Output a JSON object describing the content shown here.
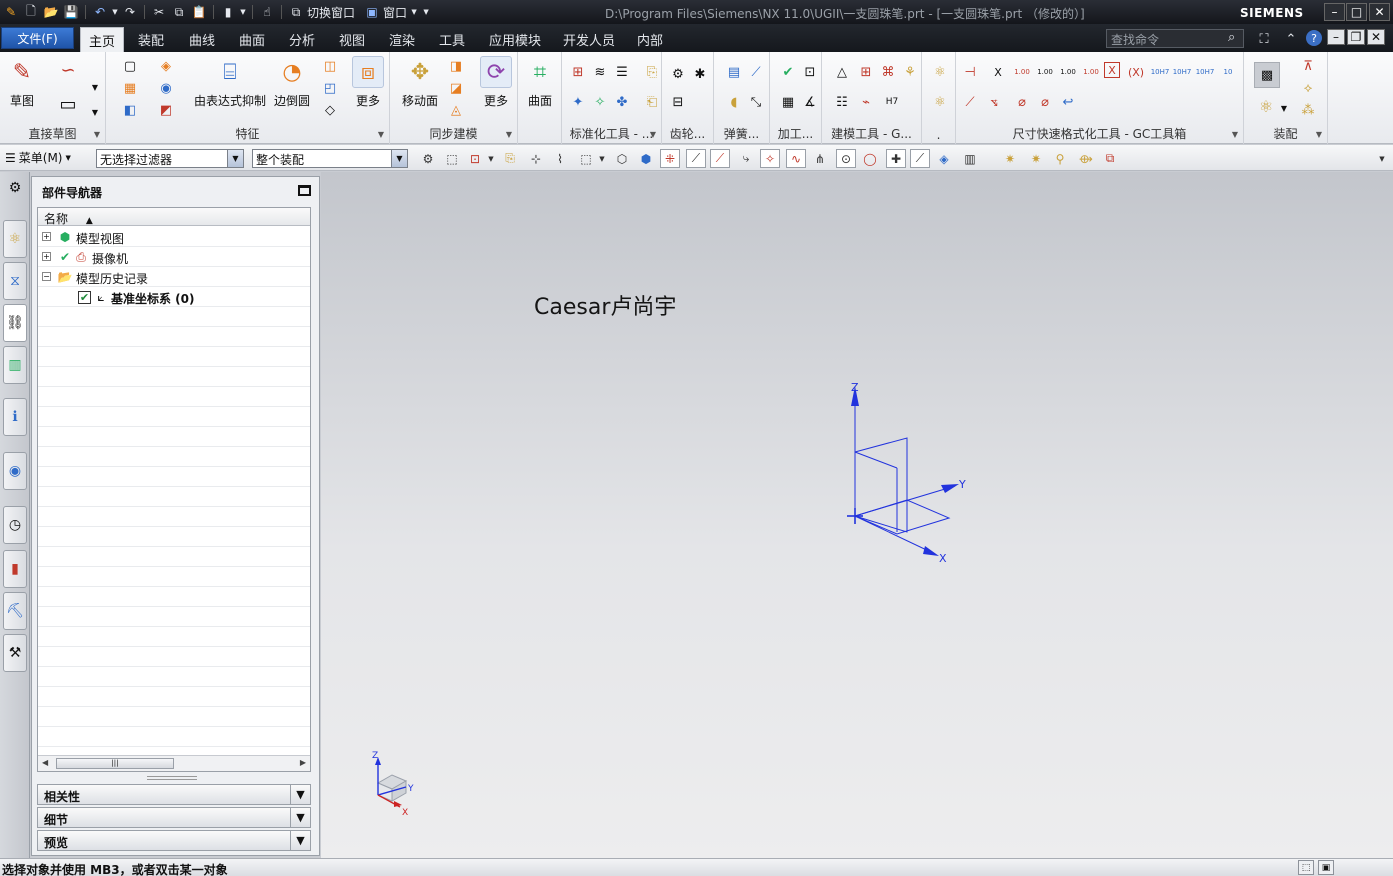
{
  "titlebar": {
    "title": "D:\\Program Files\\Siemens\\NX 11.0\\UGII\\一支圆珠笔.prt - [一支圆珠笔.prt （修改的）]",
    "brand": "SIEMENS",
    "switch_window_label": "切换窗口",
    "window_label": "窗口"
  },
  "tabs": {
    "file": "文件(F)",
    "items": [
      "主页",
      "装配",
      "曲线",
      "曲面",
      "分析",
      "视图",
      "渲染",
      "工具",
      "应用模块",
      "开发人员",
      "内部"
    ],
    "active": "主页"
  },
  "search": {
    "placeholder": "查找命令"
  },
  "ribbon": {
    "groups": {
      "direct_sketch": {
        "label": "直接草图",
        "sketch": "草图"
      },
      "feature": {
        "label": "特征",
        "expression_suppress": "由表达式抑制",
        "edge_blend": "边倒圆",
        "more": "更多"
      },
      "sync": {
        "label": "同步建模",
        "move_face": "移动面",
        "more": "更多"
      },
      "surface": {
        "label": "",
        "surface": "曲面"
      },
      "std": {
        "label": "标准化工具 - ..."
      },
      "gear": {
        "label": "齿轮..."
      },
      "spring": {
        "label": "弹簧..."
      },
      "machining": {
        "label": "加工..."
      },
      "modeling": {
        "label": "建模工具 - G..."
      },
      "misc": {
        "label": "."
      },
      "dim": {
        "label": "尺寸快速格式化工具 - GC工具箱"
      },
      "assembly": {
        "label": "装配"
      }
    }
  },
  "selbar": {
    "menu": "菜单(M)",
    "filter": "无选择过滤器",
    "scope": "整个装配"
  },
  "navigator": {
    "title": "部件导航器",
    "column": "名称",
    "nodes": {
      "model_views": "模型视图",
      "cameras": "摄像机",
      "history": "模型历史记录",
      "datum_csys": "基准坐标系 (0)"
    },
    "sections": {
      "dependencies": "相关性",
      "details": "细节",
      "preview": "预览"
    }
  },
  "graphics": {
    "watermark": "Caesar卢尚宇",
    "axes": {
      "z": "Z",
      "y": "Y",
      "x": "X"
    }
  },
  "status": {
    "text": "选择对象并使用 MB3，或者双击某一对象"
  },
  "colors": {
    "accent": "#2f6bc8",
    "csys": "#2233dd",
    "titlebar": "#1b1e24"
  }
}
